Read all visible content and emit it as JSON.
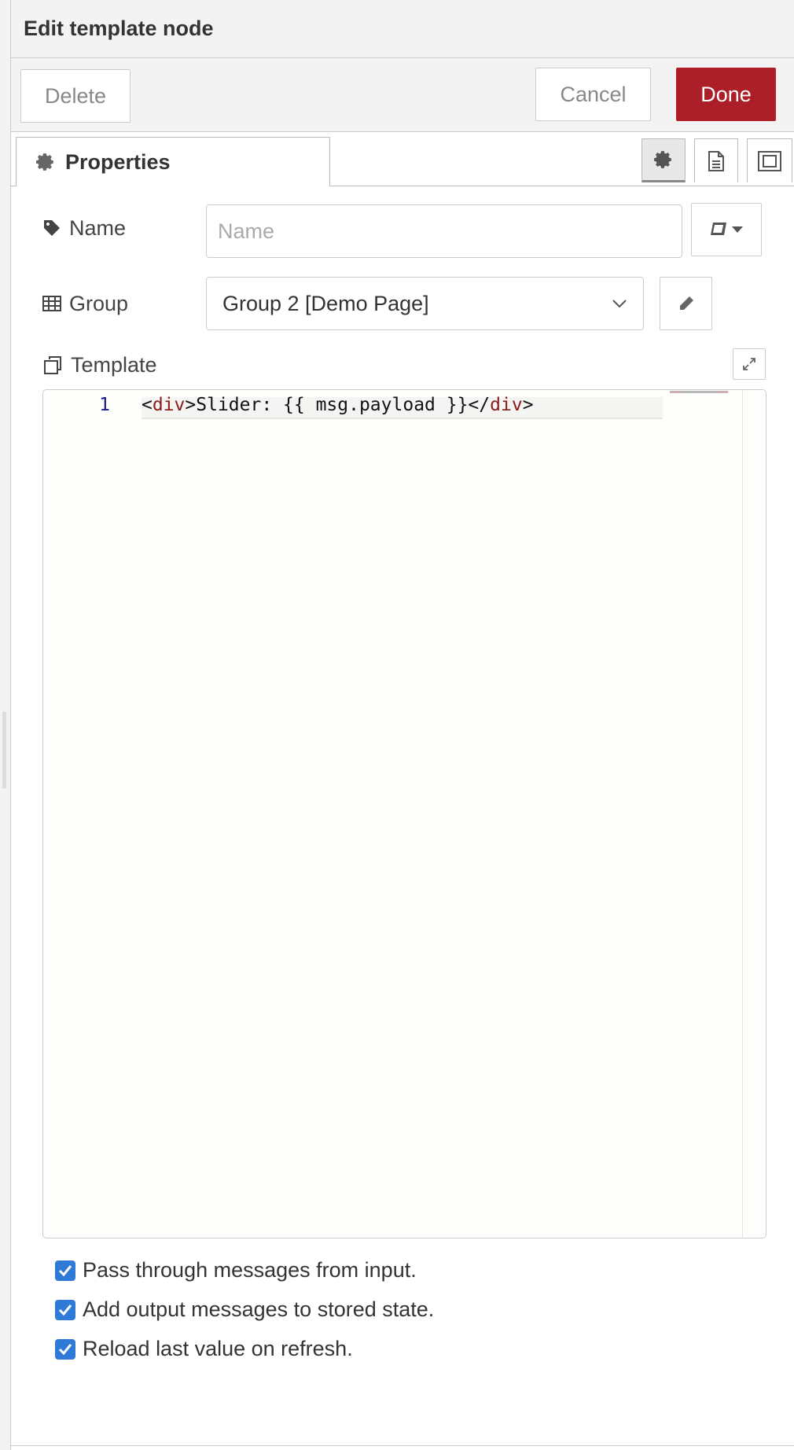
{
  "header": {
    "title": "Edit template node"
  },
  "toolbar": {
    "delete_label": "Delete",
    "cancel_label": "Cancel",
    "done_label": "Done"
  },
  "tabs": {
    "properties_label": "Properties"
  },
  "form": {
    "name": {
      "label": "Name",
      "value": "",
      "placeholder": "Name"
    },
    "group": {
      "label": "Group",
      "selected": "Group 2 [Demo Page]"
    },
    "template": {
      "label": "Template",
      "line_number": "1",
      "code_tag_open": "<div",
      "code_text": ">Slider: {{ msg.payload }}</",
      "code_tag_close": "div",
      "code_end": ">"
    }
  },
  "options": [
    {
      "label": "Pass through messages from input.",
      "checked": true
    },
    {
      "label": "Add output messages to stored state.",
      "checked": true
    },
    {
      "label": "Reload last value on refresh.",
      "checked": true
    }
  ],
  "colors": {
    "accent": "#ad1f28",
    "checkbox": "#2f7ad6",
    "tag": "#8b1a1a",
    "line_number": "#1c1c8a"
  },
  "icons": [
    "gear-icon",
    "document-icon",
    "frame-icon",
    "tag-icon",
    "table-icon",
    "book-icon",
    "caret-down-icon",
    "chevron-down-icon",
    "pencil-icon",
    "clipboard-icon",
    "expand-icon",
    "checkmark-icon"
  ]
}
